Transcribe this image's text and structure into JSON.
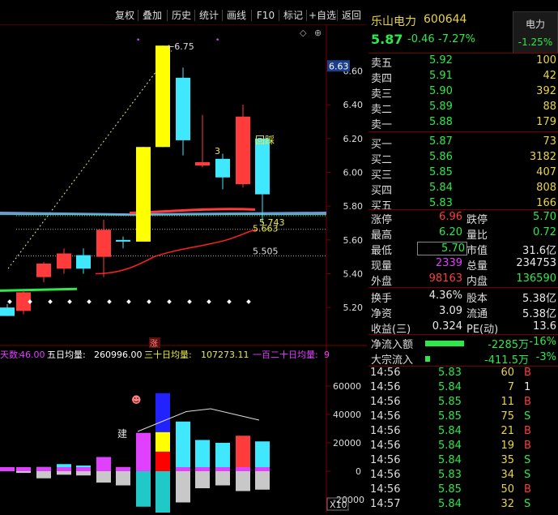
{
  "toolbar": {
    "buttons": [
      "复权",
      "叠加",
      "历史",
      "统计",
      "画线",
      "F10",
      "标记",
      "+自选",
      "返回"
    ]
  },
  "stock": {
    "name": "乐山电力",
    "code": "600644",
    "sector": "电力",
    "sector_change": "-1.25%",
    "price": "5.87",
    "change": "-0.46",
    "change_pct": "-7.27%"
  },
  "order_book": {
    "asks": [
      {
        "label": "卖五",
        "price": "5.92",
        "vol": "100"
      },
      {
        "label": "卖四",
        "price": "5.91",
        "vol": "42"
      },
      {
        "label": "卖三",
        "price": "5.90",
        "vol": "392"
      },
      {
        "label": "卖二",
        "price": "5.89",
        "vol": "88"
      },
      {
        "label": "卖一",
        "price": "5.88",
        "vol": "179"
      }
    ],
    "bids": [
      {
        "label": "买一",
        "price": "5.87",
        "vol": "73"
      },
      {
        "label": "买二",
        "price": "5.86",
        "vol": "3182"
      },
      {
        "label": "买三",
        "price": "5.85",
        "vol": "407"
      },
      {
        "label": "买四",
        "price": "5.84",
        "vol": "808"
      },
      {
        "label": "买五",
        "price": "5.83",
        "vol": "166"
      }
    ]
  },
  "stats": [
    {
      "l1": "涨停",
      "v1": "6.96",
      "c1": "red",
      "l2": "跌停",
      "v2": "5.70",
      "c2": "green"
    },
    {
      "l1": "最高",
      "v1": "6.20",
      "c1": "green",
      "l2": "量比",
      "v2": "0.72",
      "c2": "green"
    },
    {
      "l1": "最低",
      "v1": "5.70",
      "c1": "green",
      "l2": "市值",
      "v2": "31.6亿",
      "c2": "white"
    },
    {
      "l1": "现量",
      "v1": "2339",
      "c1": "magenta",
      "l2": "总量",
      "v2": "234753",
      "c2": "white"
    },
    {
      "l1": "外盘",
      "v1": "98163",
      "c1": "red",
      "l2": "内盘",
      "v2": "136590",
      "c2": "green"
    }
  ],
  "stats2": [
    {
      "l1": "换手",
      "v1": "4.36%",
      "l2": "股本",
      "v2": "5.38亿"
    },
    {
      "l1": "净资",
      "v1": "3.09",
      "l2": "流通",
      "v2": "5.38亿"
    },
    {
      "l1": "收益(三)",
      "v1": "0.324",
      "l2": "PE(动)",
      "v2": "13.6"
    }
  ],
  "flows": [
    {
      "label": "净流入额",
      "value": "-2285万",
      "pct": "-16%",
      "bar": 0.48
    },
    {
      "label": "大宗流入",
      "value": "-411.5万",
      "pct": "-3%",
      "bar": 0.06
    }
  ],
  "trades": [
    {
      "time": "14:56",
      "price": "5.83",
      "vol": "60",
      "side": "B"
    },
    {
      "time": "14:56",
      "price": "5.84",
      "vol": "7",
      "side": "1"
    },
    {
      "time": "14:56",
      "price": "5.85",
      "vol": "11",
      "side": "B"
    },
    {
      "time": "14:56",
      "price": "5.85",
      "vol": "75",
      "side": "S"
    },
    {
      "time": "14:56",
      "price": "5.84",
      "vol": "21",
      "side": "B"
    },
    {
      "time": "14:56",
      "price": "5.84",
      "vol": "19",
      "side": "B"
    },
    {
      "time": "14:56",
      "price": "5.84",
      "vol": "35",
      "side": "S"
    },
    {
      "time": "14:56",
      "price": "5.83",
      "vol": "34",
      "side": "S"
    },
    {
      "time": "14:56",
      "price": "5.85",
      "vol": "50",
      "side": "B"
    },
    {
      "time": "14:57",
      "price": "5.84",
      "vol": "32",
      "side": "S"
    }
  ],
  "chart_data": {
    "type": "candlestick",
    "price_axis": {
      "ticks": [
        5.2,
        5.4,
        5.6,
        5.8,
        6.0,
        6.2,
        6.4,
        6.6
      ],
      "current_label": "6.63",
      "ylim": [
        5.1,
        6.78
      ]
    },
    "candles": [
      {
        "o": 5.15,
        "h": 5.22,
        "l": 5.15,
        "c": 5.2,
        "color": "#40e8ff"
      },
      {
        "o": 5.18,
        "h": 5.3,
        "l": 5.16,
        "c": 5.29,
        "color": "#ff3b3b"
      },
      {
        "o": 5.38,
        "h": 5.47,
        "l": 5.35,
        "c": 5.46,
        "color": "#ff3b3b"
      },
      {
        "o": 5.43,
        "h": 5.55,
        "l": 5.4,
        "c": 5.52,
        "color": "#ff3b3b"
      },
      {
        "o": 5.51,
        "h": 5.55,
        "l": 5.4,
        "c": 5.43,
        "color": "#40e8ff"
      },
      {
        "o": 5.5,
        "h": 5.72,
        "l": 5.38,
        "c": 5.66,
        "color": "#ff3b3b"
      },
      {
        "o": 5.6,
        "h": 5.62,
        "l": 5.55,
        "c": 5.59,
        "color": "#40e8ff"
      },
      {
        "o": 5.59,
        "h": 6.15,
        "l": 5.59,
        "c": 6.15,
        "color": "#ffff00"
      },
      {
        "o": 6.15,
        "h": 6.75,
        "l": 6.15,
        "c": 6.75,
        "color": "#ffff00"
      },
      {
        "o": 6.56,
        "h": 6.62,
        "l": 6.1,
        "c": 6.19,
        "color": "#40e8ff"
      },
      {
        "o": 6.04,
        "h": 6.34,
        "l": 6.03,
        "c": 6.06,
        "color": "#ff3b3b"
      },
      {
        "o": 6.08,
        "h": 6.11,
        "l": 5.9,
        "c": 5.97,
        "color": "#40e8ff"
      },
      {
        "o": 5.93,
        "h": 6.4,
        "l": 5.91,
        "c": 6.33,
        "color": "#ff3b3b"
      },
      {
        "o": 6.2,
        "h": 6.2,
        "l": 5.7,
        "c": 5.87,
        "color": "#40e8ff"
      }
    ],
    "annotations": {
      "high": "6.75",
      "label_a": "3",
      "label_b": "回踩",
      "level1": "5.743",
      "level2": "5.663",
      "level3": "5.505",
      "marker": "涨"
    },
    "volume_header": {
      "lbl0": "天数:",
      "val0": "46.00",
      "lbl1": "五日均量:",
      "val1": "260996.00",
      "lbl2": "三十日均量:",
      "val2": "107273.11",
      "lbl3": "一百二十日均量:",
      "val3": "9"
    },
    "volume_axis": {
      "ticks": [
        60000,
        40000,
        20000,
        0,
        -20000
      ],
      "scale_label": "X10",
      "ylim": [
        -28000,
        72000
      ]
    },
    "volume_bars": [
      {
        "pos": [
          1800
        ],
        "neg": []
      },
      {
        "pos": [
          2500
        ],
        "neg": [
          -1200
        ]
      },
      {
        "pos": [
          3000
        ],
        "neg": [
          -5000
        ]
      },
      {
        "pos": [
          5000
        ],
        "neg": [
          -2500
        ]
      },
      {
        "pos": [
          4000
        ],
        "neg": [
          -3000
        ]
      },
      {
        "pos": [
          10000
        ],
        "neg": [
          -8000
        ]
      },
      {
        "pos": [
          3000
        ],
        "neg": [
          -10000
        ]
      },
      {
        "pos": [
          27000
        ],
        "neg": [
          -25000
        ]
      },
      {
        "pos": [
          55000
        ],
        "neg": [
          -48000
        ]
      },
      {
        "pos": [
          35000
        ],
        "neg": [
          -22000
        ]
      },
      {
        "pos": [
          22000
        ],
        "neg": [
          -12000
        ]
      },
      {
        "pos": [
          20000
        ],
        "neg": [
          -10000
        ]
      },
      {
        "pos": [
          25000
        ],
        "neg": [
          -14000
        ]
      },
      {
        "pos": [
          21000
        ],
        "neg": [
          -13000
        ]
      }
    ],
    "volume_label": "建"
  }
}
